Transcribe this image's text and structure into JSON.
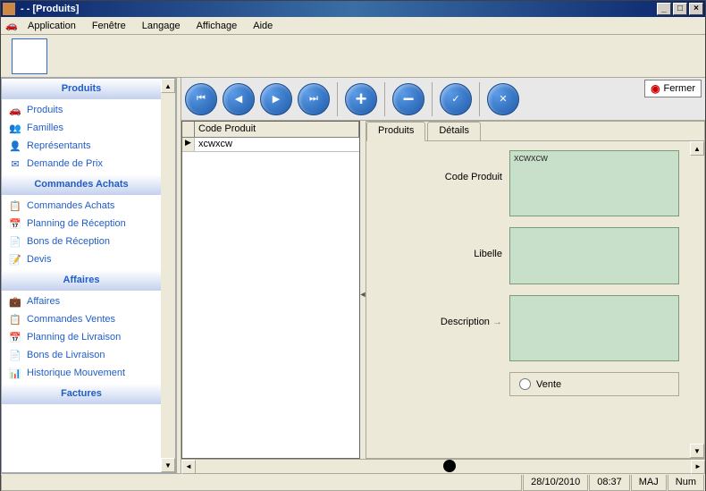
{
  "window": {
    "title": " -  - [Produits]",
    "min": "_",
    "max": "□",
    "close": "×"
  },
  "menu": {
    "items": [
      "Application",
      "Fenêtre",
      "Langage",
      "Affichage",
      "Aide"
    ]
  },
  "sidebar": {
    "scroll_up": "▲",
    "scroll_down": "▼",
    "sections": [
      {
        "title": "Produits",
        "items": [
          {
            "icon": "🚗",
            "label": "Produits"
          },
          {
            "icon": "👥",
            "label": "Familles"
          },
          {
            "icon": "👤",
            "label": "Représentants"
          },
          {
            "icon": "✉",
            "label": "Demande de Prix"
          }
        ]
      },
      {
        "title": "Commandes Achats",
        "items": [
          {
            "icon": "📋",
            "label": "Commandes Achats"
          },
          {
            "icon": "📅",
            "label": "Planning de Réception"
          },
          {
            "icon": "📄",
            "label": "Bons de Réception"
          },
          {
            "icon": "📝",
            "label": "Devis"
          }
        ]
      },
      {
        "title": "Affaires",
        "items": [
          {
            "icon": "💼",
            "label": "Affaires"
          },
          {
            "icon": "📋",
            "label": "Commandes Ventes"
          },
          {
            "icon": "📅",
            "label": "Planning de Livraison"
          },
          {
            "icon": "📄",
            "label": "Bons de Livraison"
          },
          {
            "icon": "📊",
            "label": "Historique Mouvement"
          }
        ]
      },
      {
        "title": "Factures",
        "items": []
      }
    ]
  },
  "nav": {
    "first": "⏮",
    "prev": "◀",
    "next": "▶",
    "last": "⏭",
    "add": "+",
    "remove": "−",
    "ok": "✓",
    "cancel": "✕",
    "fermer_label": "Fermer",
    "fermer_icon": "◉"
  },
  "grid": {
    "header": "Code Produit",
    "row_marker": "▶",
    "rows": [
      {
        "code": "xcwxcw"
      }
    ]
  },
  "tabs": {
    "items": [
      "Produits",
      "Détails"
    ],
    "active": 0
  },
  "form": {
    "code_produit_label": "Code Produit",
    "code_produit_value": "xcwxcw",
    "libelle_label": "Libelle",
    "libelle_value": "",
    "description_label": "Description",
    "description_arrow": "→",
    "description_value": "",
    "vente_label": "Vente"
  },
  "statusbar": {
    "date": "28/10/2010",
    "time": "08:37",
    "caps": "MAJ",
    "num": "Num"
  },
  "splitter": {
    "arrow": "◄"
  }
}
